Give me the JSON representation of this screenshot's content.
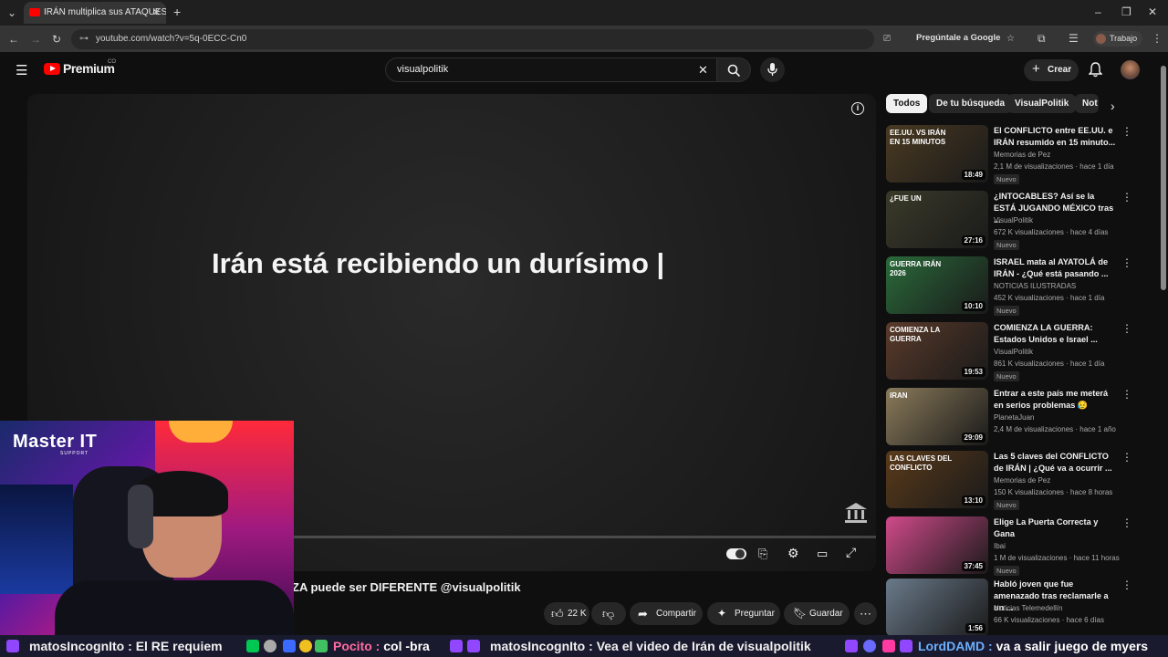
{
  "browser": {
    "tab_title": "IRÁN multiplica sus ATAQUES, ¿",
    "url": "youtube.com/watch?v=5q-0ECC-Cn0",
    "ask_google": "Pregúntale a Google",
    "profile": "Trabajo"
  },
  "youtube": {
    "logo_text": "Premium",
    "region": "CO",
    "search_value": "visualpolitik",
    "create_label": "Crear"
  },
  "player": {
    "caption_text": "Irán está recibiendo un durísimo |"
  },
  "video": {
    "title": "ZA puede ser DIFERENTE @visualpolitik",
    "likes": "22 K",
    "share": "Compartir",
    "ask": "Preguntar",
    "save": "Guardar"
  },
  "chips": [
    "Todos",
    "De tu búsqueda",
    "VisualPolitik",
    "Not"
  ],
  "recommendations": [
    {
      "title": "El CONFLICTO entre EE.UU. e IRÁN resumido en 15 minuto...",
      "channel": "Memorias de Pez",
      "meta": "2,1 M de visualizaciones · hace 1 día",
      "badge": "Nuevo",
      "duration": "18:49",
      "thumb_text": "EE.UU. VS IRÁN EN 15 MINUTOS",
      "color": "#4a3a22"
    },
    {
      "title": "¿INTOCABLES? Así se la ESTÁ JUGANDO MÉXICO tras ...",
      "channel": "VisualPolitik",
      "meta": "672 K visualizaciones · hace 4 días",
      "badge": "Nuevo",
      "duration": "27:16",
      "thumb_text": "¿FUE UN",
      "color": "#3a3a2a"
    },
    {
      "title": "ISRAEL mata al AYATOLÁ de IRÁN - ¿Qué está pasando ...",
      "channel": "NOTICIAS ILUSTRADAS",
      "meta": "452 K visualizaciones · hace 1 día",
      "badge": "Nuevo",
      "duration": "10:10",
      "thumb_text": "GUERRA IRÁN 2026",
      "color": "#2a6a3a"
    },
    {
      "title": "COMIENZA LA GUERRA: Estados Unidos e Israel ...",
      "channel": "VisualPolitik",
      "meta": "861 K visualizaciones · hace 1 día",
      "badge": "Nuevo",
      "duration": "19:53",
      "thumb_text": "COMIENZA LA GUERRA",
      "color": "#5a3a2a"
    },
    {
      "title": "Entrar a este país me meterá en serios problemas 😥",
      "channel": "PlanetaJuan",
      "meta": "2,4 M de visualizaciones · hace 1 año",
      "badge": "",
      "duration": "29:09",
      "thumb_text": "IRAN",
      "color": "#8a7a5a"
    },
    {
      "title": "Las 5 claves del CONFLICTO de IRÁN | ¿Qué va a ocurrir ...",
      "channel": "Memorias de Pez",
      "meta": "150 K visualizaciones · hace 8 horas",
      "badge": "Nuevo",
      "duration": "13:10",
      "thumb_text": "LAS CLAVES DEL CONFLICTO",
      "color": "#5a3a1a"
    },
    {
      "title": "Elige La Puerta Correcta y Gana",
      "channel": "Ibai",
      "meta": "1 M de visualizaciones · hace 11 horas",
      "badge": "Nuevo",
      "duration": "37:45",
      "thumb_text": "",
      "color": "#d04a8a"
    },
    {
      "title": "Habló joven que fue amenazado tras reclamarle a un ...",
      "channel": "Noticias Telemedellín",
      "meta": "66 K visualizaciones · hace 6 días",
      "badge": "",
      "duration": "1:56",
      "thumb_text": "",
      "color": "#6a7a8a"
    }
  ],
  "overlay": {
    "brand": "Master IT",
    "brand_sub": "SUPPORT"
  },
  "chat": [
    {
      "user": "matosIncognIto",
      "msg": "El RE requiem",
      "color": "#ffffff"
    },
    {
      "user": "Pocito",
      "msg": "col -bra",
      "color": "#ff6aa0"
    },
    {
      "user": "matosIncognIto",
      "msg": "Vea el video de Irán de visualpolitik",
      "color": "#ffffff"
    },
    {
      "user": "LordDAMD",
      "msg": "va a salir juego de myers",
      "color": "#6ab0ff"
    }
  ],
  "colors": {
    "youtube_red": "#ff0000",
    "bg": "#0f0f0f"
  }
}
